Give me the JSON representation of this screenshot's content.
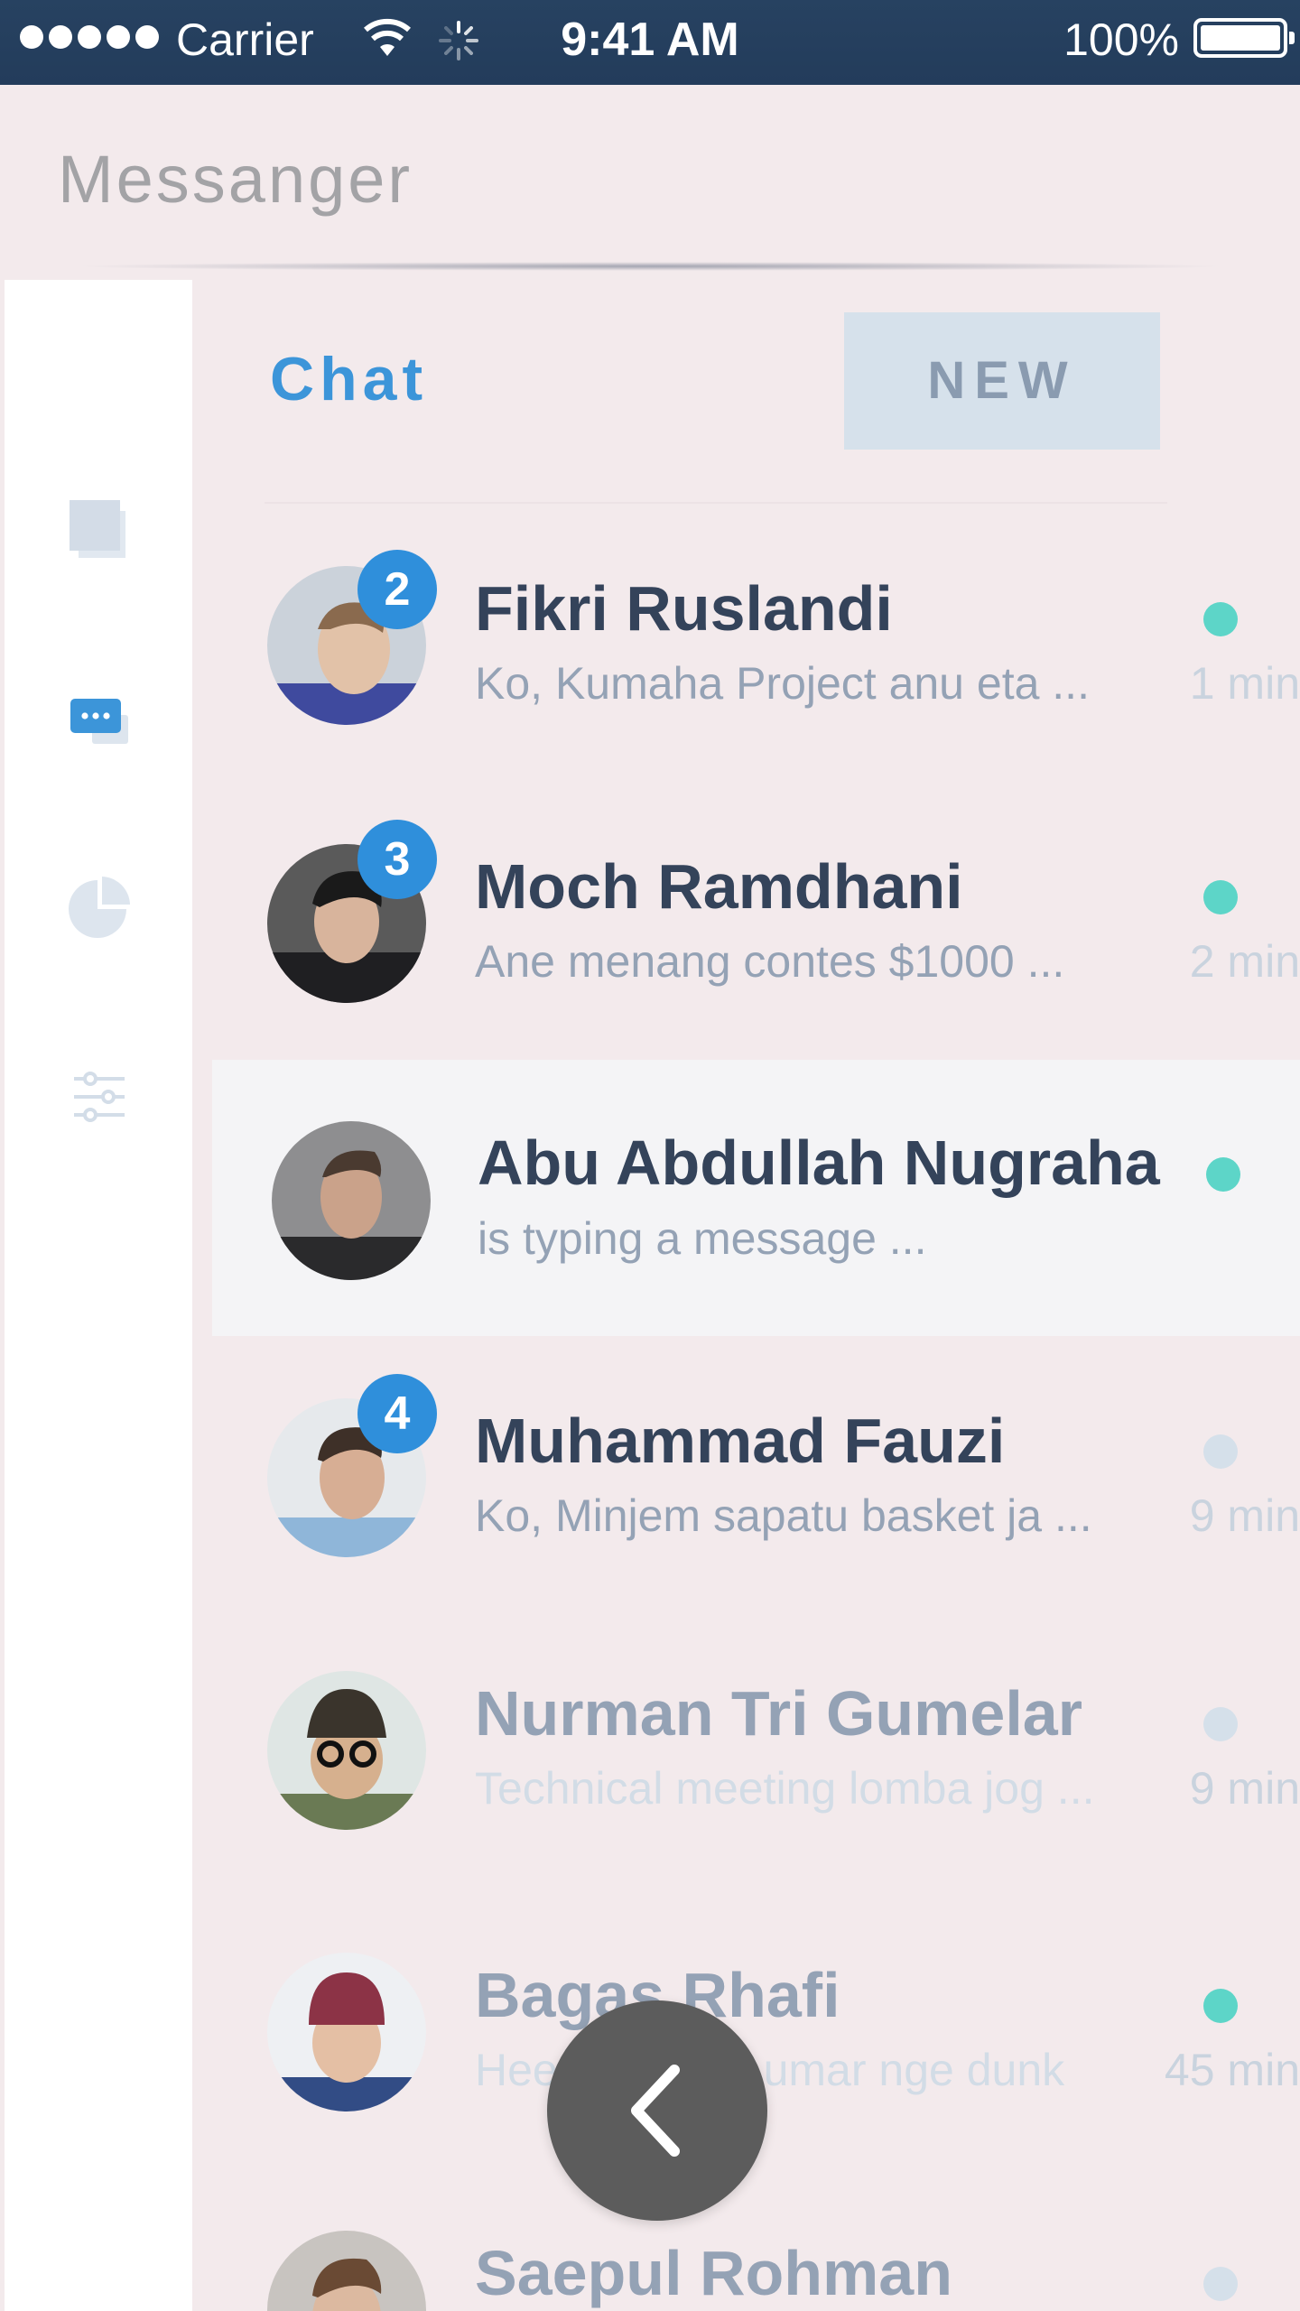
{
  "status_bar": {
    "carrier": "Carrier",
    "time": "9:41 AM",
    "battery": "100%"
  },
  "header": {
    "title": "Messanger"
  },
  "tabs": {
    "active": "Chat",
    "new_button": "NEW"
  },
  "sidebar": {
    "items": [
      {
        "icon": "squares-icon"
      },
      {
        "icon": "chat-bubbles-icon",
        "active": true
      },
      {
        "icon": "pie-chart-icon"
      },
      {
        "icon": "sliders-icon"
      }
    ]
  },
  "colors": {
    "accent": "#3c95d9",
    "online": "#5dd5c8",
    "offline": "#d5e0ea",
    "name_dark": "#34435a",
    "name_muted": "#94a2b5"
  },
  "chats": [
    {
      "name": "Fikri Ruslandi",
      "preview": "Ko, Kumaha Project anu eta ...",
      "time": "1 min",
      "unread": "2",
      "online": true
    },
    {
      "name": "Moch Ramdhani",
      "preview": "Ane menang contes $1000 ...",
      "time": "2 min",
      "unread": "3",
      "online": true
    },
    {
      "name": "Abu Abdullah Nugraha",
      "preview": "is typing a message ...",
      "time": "",
      "unread": "",
      "online": true
    },
    {
      "name": "Muhammad Fauzi",
      "preview": "Ko, Minjem sapatu basket ja ...",
      "time": "9 min",
      "unread": "4",
      "online": false
    },
    {
      "name": "Nurman Tri Gumelar",
      "preview": "Technical meeting lomba jog ...",
      "time": "9 min",
      "unread": "",
      "online": false
    },
    {
      "name": "Bagas Rhafi",
      "preview": "Heeem, Hayu umar nge dunk",
      "time": "45 min",
      "unread": "",
      "online": true
    },
    {
      "name": "Saepul Rohman",
      "preview": "",
      "time": "",
      "unread": "",
      "online": false
    }
  ]
}
